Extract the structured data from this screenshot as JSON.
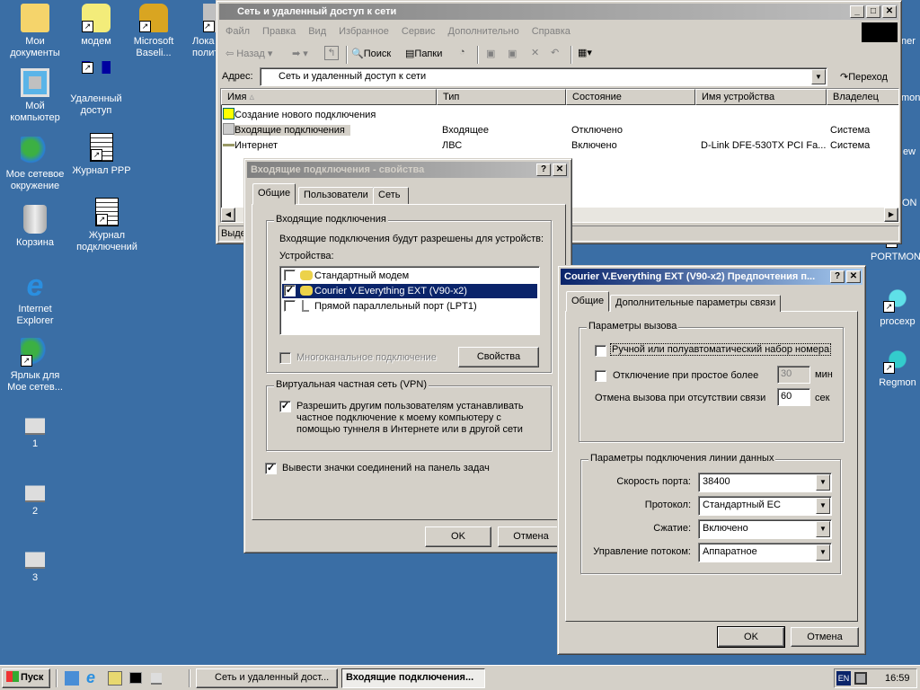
{
  "desktop": {
    "icons_left": [
      {
        "label": "Мои документы",
        "icon": "my-documents-icon"
      },
      {
        "label": "Мой компьютер",
        "icon": "my-computer-icon"
      },
      {
        "label": "Мое сетевое окружение",
        "icon": "network-places-icon"
      },
      {
        "label": "Корзина",
        "icon": "recycle-bin-icon"
      },
      {
        "label": "Internet Explorer",
        "icon": "ie-icon"
      },
      {
        "label": "Ярлык для Мое сетев...",
        "icon": "network-shortcut-icon"
      },
      {
        "label": "1",
        "icon": "pencil-cup-icon"
      },
      {
        "label": "2",
        "icon": "pencil-cup-icon"
      },
      {
        "label": "3",
        "icon": "pencil-cup-icon"
      }
    ],
    "icons_col2": [
      {
        "label": "модем",
        "icon": "phone-icon"
      },
      {
        "label": "Удаленный доступ",
        "icon": "remote-access-icon"
      },
      {
        "label": "Журнал PPP",
        "icon": "log-icon"
      },
      {
        "label": "Журнал подключений",
        "icon": "log-icon"
      }
    ],
    "icons_col3": [
      {
        "label": "Microsoft Baseli...",
        "icon": "lock-check-icon"
      }
    ],
    "icons_col4": [
      {
        "label": "Лока политик",
        "icon": "policy-icon"
      }
    ],
    "icons_right": [
      {
        "label": "ner"
      },
      {
        "label": "mon"
      },
      {
        "label": "ew"
      },
      {
        "label": "ON"
      },
      {
        "label": "PORTMON"
      },
      {
        "label": "procexp"
      },
      {
        "label": "Regmon"
      }
    ]
  },
  "explorer": {
    "title": "Сеть и удаленный доступ к сети",
    "menu": [
      "Файл",
      "Правка",
      "Вид",
      "Избранное",
      "Сервис",
      "Дополнительно",
      "Справка"
    ],
    "toolbar": {
      "back": "Назад",
      "search": "Поиск",
      "folders": "Папки"
    },
    "address_label": "Адрес:",
    "address_value": "Сеть и удаленный доступ к сети",
    "go": "Переход",
    "columns": [
      "Имя",
      "Тип",
      "Состояние",
      "Имя устройства",
      "Владелец"
    ],
    "rows": [
      {
        "name": "Создание нового подключения",
        "type": "",
        "state": "",
        "device": "",
        "owner": ""
      },
      {
        "name": "Входящие подключения",
        "type": "Входящее",
        "state": "Отключено",
        "device": "",
        "owner": "Система"
      },
      {
        "name": "Интернет",
        "type": "ЛВС",
        "state": "Включено",
        "device": "D-Link DFE-530TX PCI Fa...",
        "owner": "Система"
      }
    ],
    "status": "Выде"
  },
  "incoming": {
    "title": "Входящие подключения - свойства",
    "tabs": [
      "Общие",
      "Пользователи",
      "Сеть"
    ],
    "group1": "Входящие подключения",
    "desc": "Входящие подключения будут разрешены для устройств:",
    "devices_label": "Устройства:",
    "devices": [
      {
        "label": "Стандартный модем",
        "checked": false
      },
      {
        "label": "Courier V.Everything EXT (V90-x2)",
        "checked": true
      },
      {
        "label": "Прямой параллельный порт (LPT1)",
        "checked": false
      }
    ],
    "multilink": "Многоканальное подключение",
    "properties": "Свойства",
    "vpn_group": "Виртуальная частная сеть (VPN)",
    "vpn_check": "Разрешить другим пользователям устанавливать частное подключение к моему компьютеру с помощью туннеля в Интернете или в другой сети",
    "show_icon": "Вывести значки соединений на панель задач",
    "ok": "OK",
    "cancel": "Отмена"
  },
  "modem": {
    "title": "Courier V.Everything EXT (V90-x2) Предпочтения п...",
    "tabs": [
      "Общие",
      "Дополнительные параметры связи"
    ],
    "call_group": "Параметры вызова",
    "manual_dial": "Ручной или полуавтоматический набор номера",
    "idle_disconnect": "Отключение при простое более",
    "idle_value": "30",
    "idle_unit": "мин",
    "cancel_call": "Отмена вызова при отсутствии связи",
    "cancel_value": "60",
    "cancel_unit": "сек",
    "data_group": "Параметры подключения линии данных",
    "port_speed_label": "Скорость порта:",
    "port_speed": "38400",
    "protocol_label": "Протокол:",
    "protocol": "Стандартный EC",
    "compression_label": "Сжатие:",
    "compression": "Включено",
    "flow_label": "Управление потоком:",
    "flow": "Аппаратное",
    "ok": "OK",
    "cancel": "Отмена"
  },
  "taskbar": {
    "start": "Пуск",
    "tasks": [
      "Сеть и удаленный дост...",
      "Входящие подключения..."
    ],
    "lang": "EN",
    "clock": "16:59"
  },
  "colors": {
    "desktop": "#3a6ea5",
    "title_active": "#0a246a",
    "face": "#d4d0c8"
  }
}
